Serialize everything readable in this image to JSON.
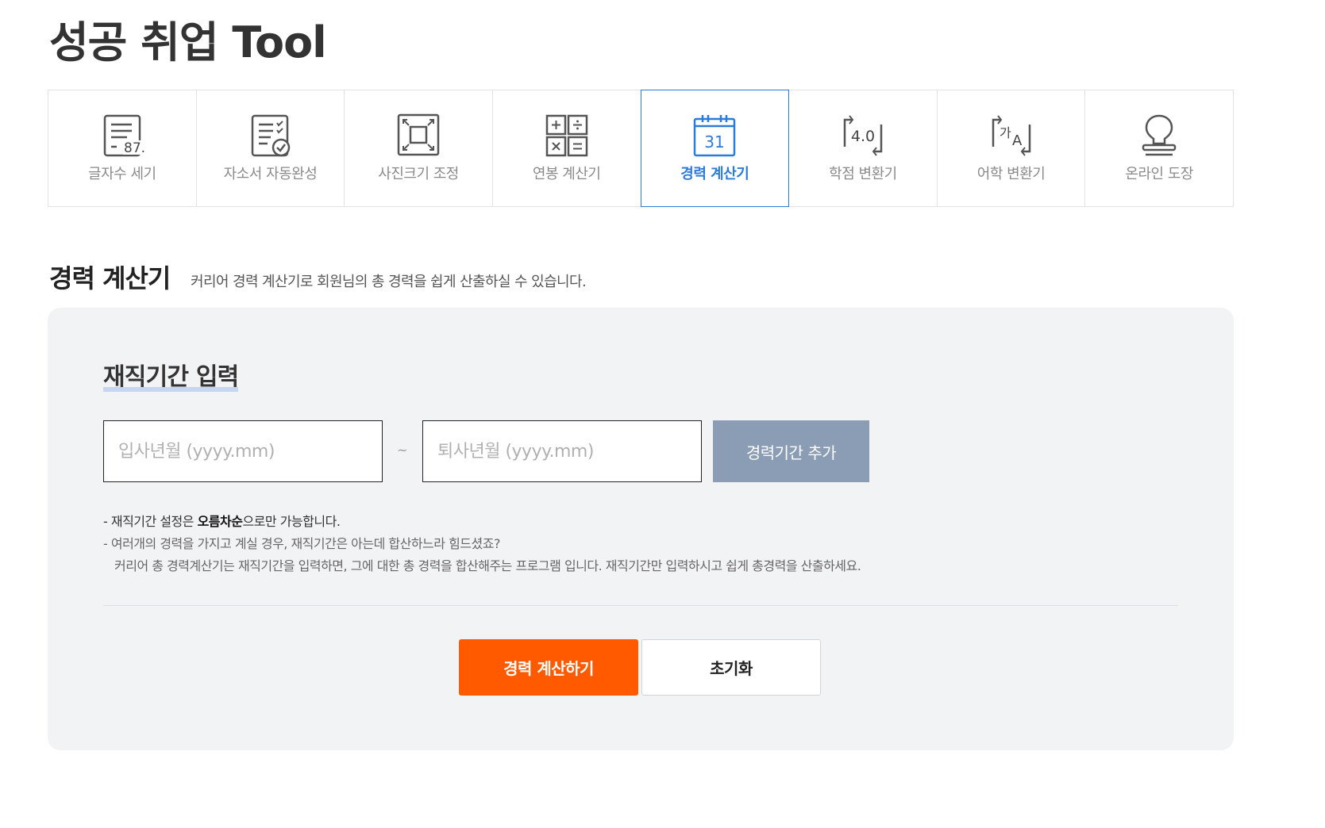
{
  "page_title": "성공 취업 Tool",
  "tools": [
    {
      "label": "글자수 세기",
      "icon": "document-count-icon"
    },
    {
      "label": "자소서 자동완성",
      "icon": "document-check-icon"
    },
    {
      "label": "사진크기 조정",
      "icon": "resize-icon"
    },
    {
      "label": "연봉 계산기",
      "icon": "calculator-icon"
    },
    {
      "label": "경력 계산기",
      "icon": "calendar-icon",
      "active": true
    },
    {
      "label": "학점 변환기",
      "icon": "grade-convert-icon"
    },
    {
      "label": "어학 변환기",
      "icon": "language-convert-icon"
    },
    {
      "label": "온라인 도장",
      "icon": "stamp-icon"
    }
  ],
  "icon_texts": {
    "count": "87..",
    "calendar_day": "31",
    "grade": "4.0",
    "lang_ko": "가",
    "lang_en": "A"
  },
  "section": {
    "title": "경력 계산기",
    "description": "커리어 경력 계산기로 회원님의 총 경력을 쉽게 산출하실 수 있습니다."
  },
  "form": {
    "heading": "재직기간 입력",
    "start_placeholder": "입사년월 (yyyy.mm)",
    "end_placeholder": "퇴사년월 (yyyy.mm)",
    "separator": "~",
    "add_label": "경력기간 추가"
  },
  "notes": {
    "line1_prefix": "- 재직기간 설정은 ",
    "line1_strong": "오름차순",
    "line1_suffix": "으로만 가능합니다.",
    "line2": "- 여러개의 경력을 가지고 계실 경우, 재직기간은 아는데 합산하느라 힘드셨죠?",
    "line3": "커리어 총 경력계산기는 재직기간을 입력하면, 그에 대한 총 경력을 합산해주는 프로그램 입니다. 재직기간만 입력하시고 쉽게 총경력을 산출하세요."
  },
  "buttons": {
    "calculate": "경력 계산하기",
    "reset": "초기화"
  },
  "colors": {
    "accent_blue": "#2d7bd9",
    "primary_orange": "#ff5a00",
    "add_button": "#8a9db4",
    "panel_bg": "#f1f3f5"
  }
}
